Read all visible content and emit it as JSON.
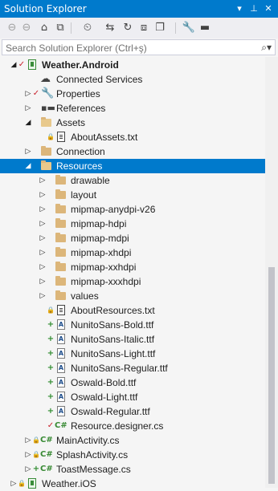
{
  "window": {
    "title": "Solution Explorer",
    "pin_icon": "pin-icon",
    "close_icon": "close-icon"
  },
  "toolbar": {
    "tools": [
      {
        "name": "back-icon",
        "glyph": "⊖"
      },
      {
        "name": "forward-icon",
        "glyph": "⊖"
      },
      {
        "name": "home-icon",
        "glyph": "⌂"
      },
      {
        "name": "vs-icon",
        "glyph": "⧉"
      },
      {
        "name": "history-icon",
        "glyph": "⏲"
      },
      {
        "name": "sync-icon",
        "glyph": "⇆"
      },
      {
        "name": "refresh-icon",
        "glyph": "↻"
      },
      {
        "name": "collapse-all-icon",
        "glyph": "⧈"
      },
      {
        "name": "show-all-files-icon",
        "glyph": "❐"
      },
      {
        "name": "properties-wrench-icon",
        "glyph": "🔧"
      },
      {
        "name": "preview-icon",
        "glyph": "▬"
      }
    ]
  },
  "search": {
    "placeholder": "Search Solution Explorer (Ctrl+ş)",
    "icon": "search-icon"
  },
  "tree": [
    {
      "label": "Weather.Android",
      "bold": true,
      "arrow": "open",
      "status": "check",
      "icon": "android-project-icon"
    },
    {
      "label": "Connected Services",
      "arrow": "none",
      "status": "",
      "icon": "cloud-icon"
    },
    {
      "label": "Properties",
      "arrow": "closed",
      "status": "check",
      "icon": "wrench-icon"
    },
    {
      "label": "References",
      "arrow": "closed",
      "status": "",
      "icon": "references-icon"
    },
    {
      "label": "Assets",
      "arrow": "open",
      "status": "",
      "icon": "folder-open-icon"
    },
    {
      "label": "AboutAssets.txt",
      "arrow": "none",
      "status": "lock",
      "icon": "text-file-icon"
    },
    {
      "label": "Connection",
      "arrow": "closed",
      "status": "",
      "icon": "folder-icon"
    },
    {
      "label": "Resources",
      "arrow": "open",
      "status": "",
      "icon": "folder-open-icon",
      "selected": true
    },
    {
      "label": "drawable",
      "arrow": "closed",
      "status": "",
      "icon": "folder-icon"
    },
    {
      "label": "layout",
      "arrow": "closed",
      "status": "",
      "icon": "folder-icon"
    },
    {
      "label": "mipmap-anydpi-v26",
      "arrow": "closed",
      "status": "",
      "icon": "folder-icon"
    },
    {
      "label": "mipmap-hdpi",
      "arrow": "closed",
      "status": "",
      "icon": "folder-icon"
    },
    {
      "label": "mipmap-mdpi",
      "arrow": "closed",
      "status": "",
      "icon": "folder-icon"
    },
    {
      "label": "mipmap-xhdpi",
      "arrow": "closed",
      "status": "",
      "icon": "folder-icon"
    },
    {
      "label": "mipmap-xxhdpi",
      "arrow": "closed",
      "status": "",
      "icon": "folder-icon"
    },
    {
      "label": "mipmap-xxxhdpi",
      "arrow": "closed",
      "status": "",
      "icon": "folder-icon"
    },
    {
      "label": "values",
      "arrow": "closed",
      "status": "",
      "icon": "folder-icon"
    },
    {
      "label": "AboutResources.txt",
      "arrow": "none",
      "status": "lock",
      "icon": "text-file-icon"
    },
    {
      "label": "NunitoSans-Bold.ttf",
      "arrow": "none",
      "status": "plus",
      "icon": "font-file-icon"
    },
    {
      "label": "NunitoSans-Italic.ttf",
      "arrow": "none",
      "status": "plus",
      "icon": "font-file-icon"
    },
    {
      "label": "NunitoSans-Light.ttf",
      "arrow": "none",
      "status": "plus",
      "icon": "font-file-icon"
    },
    {
      "label": "NunitoSans-Regular.ttf",
      "arrow": "none",
      "status": "plus",
      "icon": "font-file-icon"
    },
    {
      "label": "Oswald-Bold.ttf",
      "arrow": "none",
      "status": "plus",
      "icon": "font-file-icon"
    },
    {
      "label": "Oswald-Light.ttf",
      "arrow": "none",
      "status": "plus",
      "icon": "font-file-icon"
    },
    {
      "label": "Oswald-Regular.ttf",
      "arrow": "none",
      "status": "plus",
      "icon": "font-file-icon"
    },
    {
      "label": "Resource.designer.cs",
      "arrow": "none",
      "status": "check",
      "icon": "csharp-file-icon"
    },
    {
      "label": "MainActivity.cs",
      "arrow": "closed",
      "status": "lock",
      "icon": "csharp-file-icon"
    },
    {
      "label": "SplashActivity.cs",
      "arrow": "closed",
      "status": "lock",
      "icon": "csharp-file-icon"
    },
    {
      "label": "ToastMessage.cs",
      "arrow": "closed",
      "status": "plus",
      "icon": "csharp-file-icon"
    },
    {
      "label": "Weather.iOS",
      "arrow": "closed",
      "status": "lock",
      "icon": "ios-project-icon"
    }
  ],
  "colors": {
    "accent": "#007acc",
    "folder": "#dcb67a",
    "background": "#f5f5f5"
  }
}
